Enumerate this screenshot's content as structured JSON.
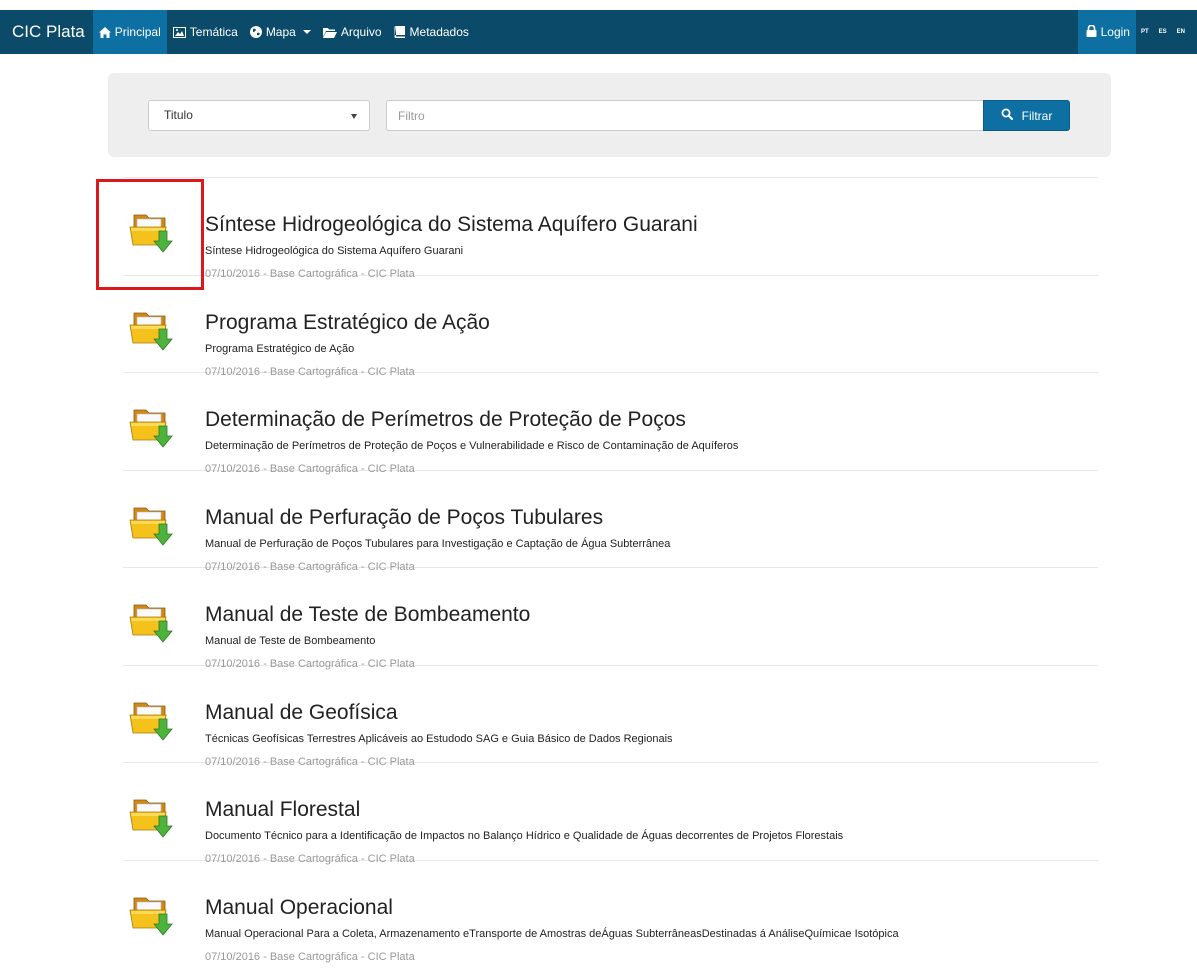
{
  "navbar": {
    "brand": "CIC Plata",
    "items": [
      {
        "label": "Principal",
        "icon": "home-icon",
        "active": true
      },
      {
        "label": "Temática",
        "icon": "picture-icon"
      },
      {
        "label": "Mapa",
        "icon": "globe-icon",
        "dropdown": true
      },
      {
        "label": "Arquivo",
        "icon": "folder-open-icon"
      },
      {
        "label": "Metadados",
        "icon": "book-icon"
      }
    ],
    "login": "Login",
    "languages": [
      "PT",
      "ES",
      "EN"
    ]
  },
  "search": {
    "select_value": "Titulo",
    "filter_placeholder": "Filtro",
    "filter_button": "Filtrar"
  },
  "documents": [
    {
      "title": "Síntese Hidrogeológica do Sistema Aquífero Guarani",
      "description": "Síntese Hidrogeológica do Sistema Aquífero Guarani",
      "meta": "07/10/2016 - Base Cartográfica - CIC Plata"
    },
    {
      "title": "Programa Estratégico de Ação",
      "description": "Programa Estratégico de Ação",
      "meta": "07/10/2016 - Base Cartográfica - CIC Plata"
    },
    {
      "title": "Determinação de Perímetros de Proteção de Poços",
      "description": "Determinação de Perímetros de Proteção de Poços e Vulnerabilidade e Risco de Contaminação de Aquíferos",
      "meta": "07/10/2016 - Base Cartográfica - CIC Plata"
    },
    {
      "title": "Manual de Perfuração de Poços Tubulares",
      "description": "Manual de Perfuração de Poços Tubulares para Investigação e Captação de Água Subterrânea",
      "meta": "07/10/2016 - Base Cartográfica - CIC Plata"
    },
    {
      "title": "Manual de Teste de Bombeamento",
      "description": "Manual de Teste de Bombeamento",
      "meta": "07/10/2016 - Base Cartográfica - CIC Plata"
    },
    {
      "title": "Manual de Geofísica",
      "description": "Técnicas Geofísicas Terrestres Aplicáveis ao Estudodo SAG e Guia Básico de Dados Regionais",
      "meta": "07/10/2016 - Base Cartográfica - CIC Plata"
    },
    {
      "title": "Manual Florestal",
      "description": "Documento Técnico para a Identificação de Impactos no Balanço Hídrico e Qualidade de Águas decorrentes de Projetos Florestais",
      "meta": "07/10/2016 - Base Cartográfica - CIC Plata"
    },
    {
      "title": "Manual Operacional",
      "description": "Manual Operacional Para a Coleta, Armazenamento eTransporte de Amostras deÁguas SubterrâneasDestinadas á AnáliseQuímicae Isotópica",
      "meta": "07/10/2016 - Base Cartográfica - CIC Plata"
    }
  ],
  "item_icon": "folder-download-icon",
  "colors": {
    "navbar": "#0b4a68",
    "accent": "#0e6fa3",
    "highlight": "#d9191c"
  }
}
